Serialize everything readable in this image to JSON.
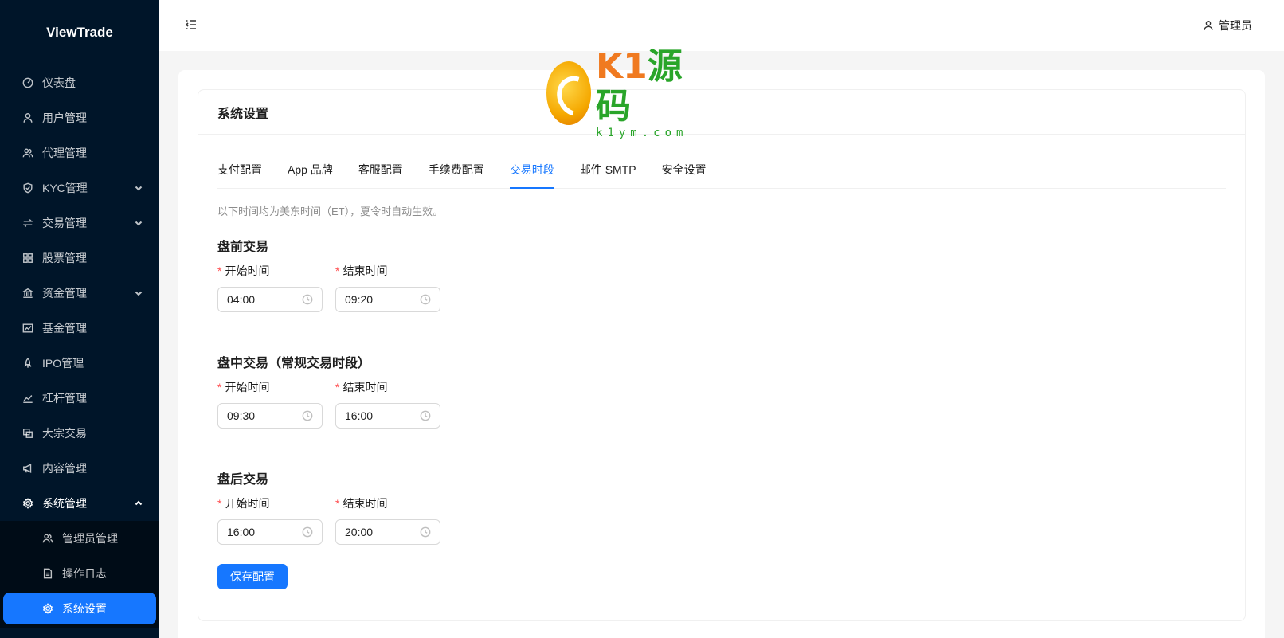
{
  "app": {
    "brand": "ViewTrade"
  },
  "header": {
    "user": "管理员"
  },
  "sidebar": {
    "items": [
      {
        "label": "仪表盘"
      },
      {
        "label": "用户管理"
      },
      {
        "label": "代理管理"
      },
      {
        "label": "KYC管理"
      },
      {
        "label": "交易管理"
      },
      {
        "label": "股票管理"
      },
      {
        "label": "资金管理"
      },
      {
        "label": "基金管理"
      },
      {
        "label": "IPO管理"
      },
      {
        "label": "杠杆管理"
      },
      {
        "label": "大宗交易"
      },
      {
        "label": "内容管理"
      },
      {
        "label": "系统管理"
      }
    ],
    "sub_items": [
      {
        "label": "管理员管理"
      },
      {
        "label": "操作日志"
      },
      {
        "label": "系统设置"
      }
    ]
  },
  "card": {
    "title": "系统设置"
  },
  "tabs": [
    {
      "label": "支付配置"
    },
    {
      "label": "App 品牌"
    },
    {
      "label": "客服配置"
    },
    {
      "label": "手续费配置"
    },
    {
      "label": "交易时段"
    },
    {
      "label": "邮件 SMTP"
    },
    {
      "label": "安全设置"
    }
  ],
  "active_tab": "交易时段",
  "hint": "以下时间均为美东时间（ET），夏令时自动生效。",
  "sections": [
    {
      "title": "盘前交易",
      "start_label": "开始时间",
      "end_label": "结束时间",
      "start": "04:00",
      "end": "09:20"
    },
    {
      "title": "盘中交易（常规交易时段）",
      "start_label": "开始时间",
      "end_label": "结束时间",
      "start": "09:30",
      "end": "16:00"
    },
    {
      "title": "盘后交易",
      "start_label": "开始时间",
      "end_label": "结束时间",
      "start": "16:00",
      "end": "20:00"
    }
  ],
  "required_mark": "*",
  "save_label": "保存配置",
  "watermark": {
    "main_a": "K1",
    "main_b": "源码",
    "sub": "k1ym.com"
  },
  "colors": {
    "primary": "#1677ff",
    "sidebar_bg": "#001529",
    "required": "#ff4d4f"
  }
}
